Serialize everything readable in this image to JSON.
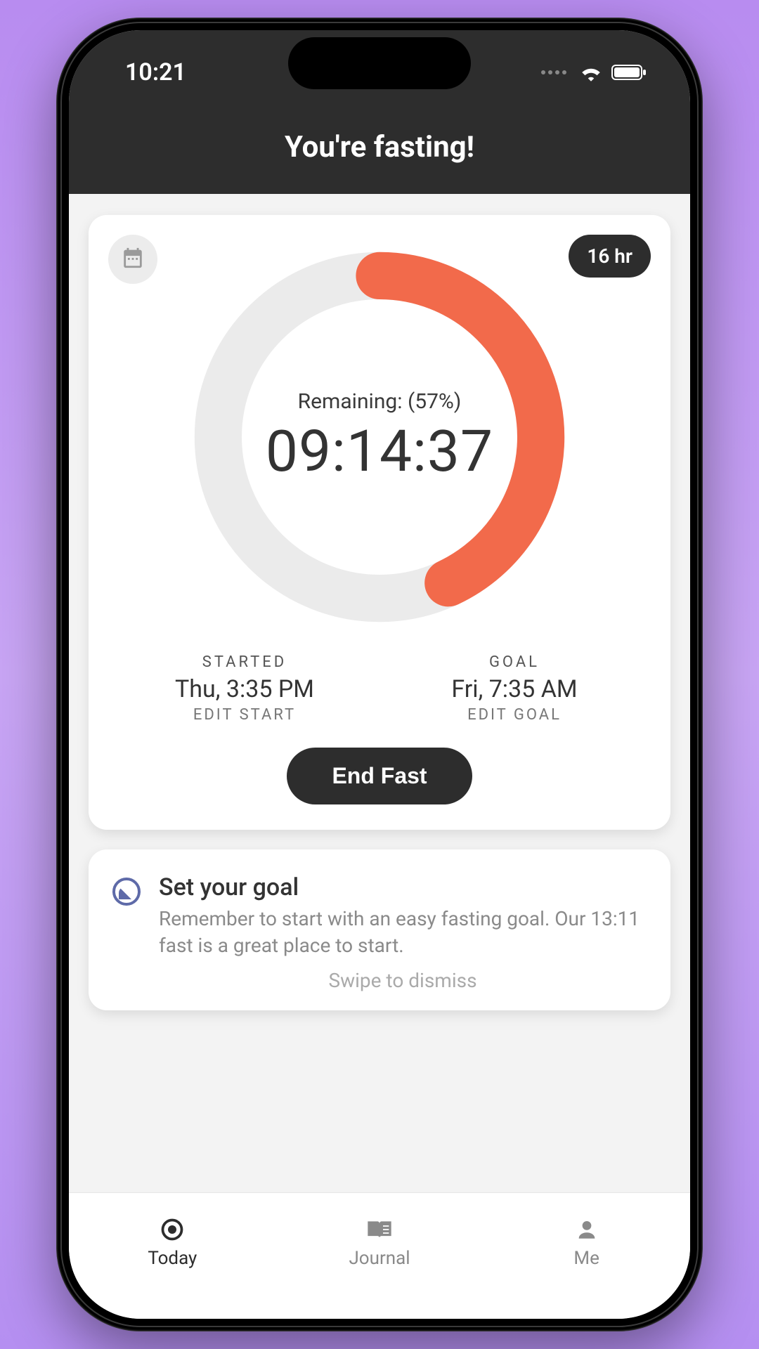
{
  "status": {
    "time": "10:21"
  },
  "header": {
    "title": "You're fasting!"
  },
  "timer_card": {
    "duration_pill": "16 hr",
    "remaining_label": "Remaining: (57%)",
    "timer": "09:14:37",
    "progress_percent": 43,
    "started": {
      "label": "STARTED",
      "value": "Thu, 3:35 PM",
      "edit": "EDIT START"
    },
    "goal": {
      "label": "GOAL",
      "value": "Fri, 7:35 AM",
      "edit": "EDIT GOAL"
    },
    "end_button": "End Fast"
  },
  "tip": {
    "title": "Set your goal",
    "text": "Remember to start with an easy fasting goal. Our 13:11 fast is a great place to start.",
    "dismiss": "Swipe to dismiss"
  },
  "tabs": {
    "today": "Today",
    "journal": "Journal",
    "me": "Me"
  }
}
